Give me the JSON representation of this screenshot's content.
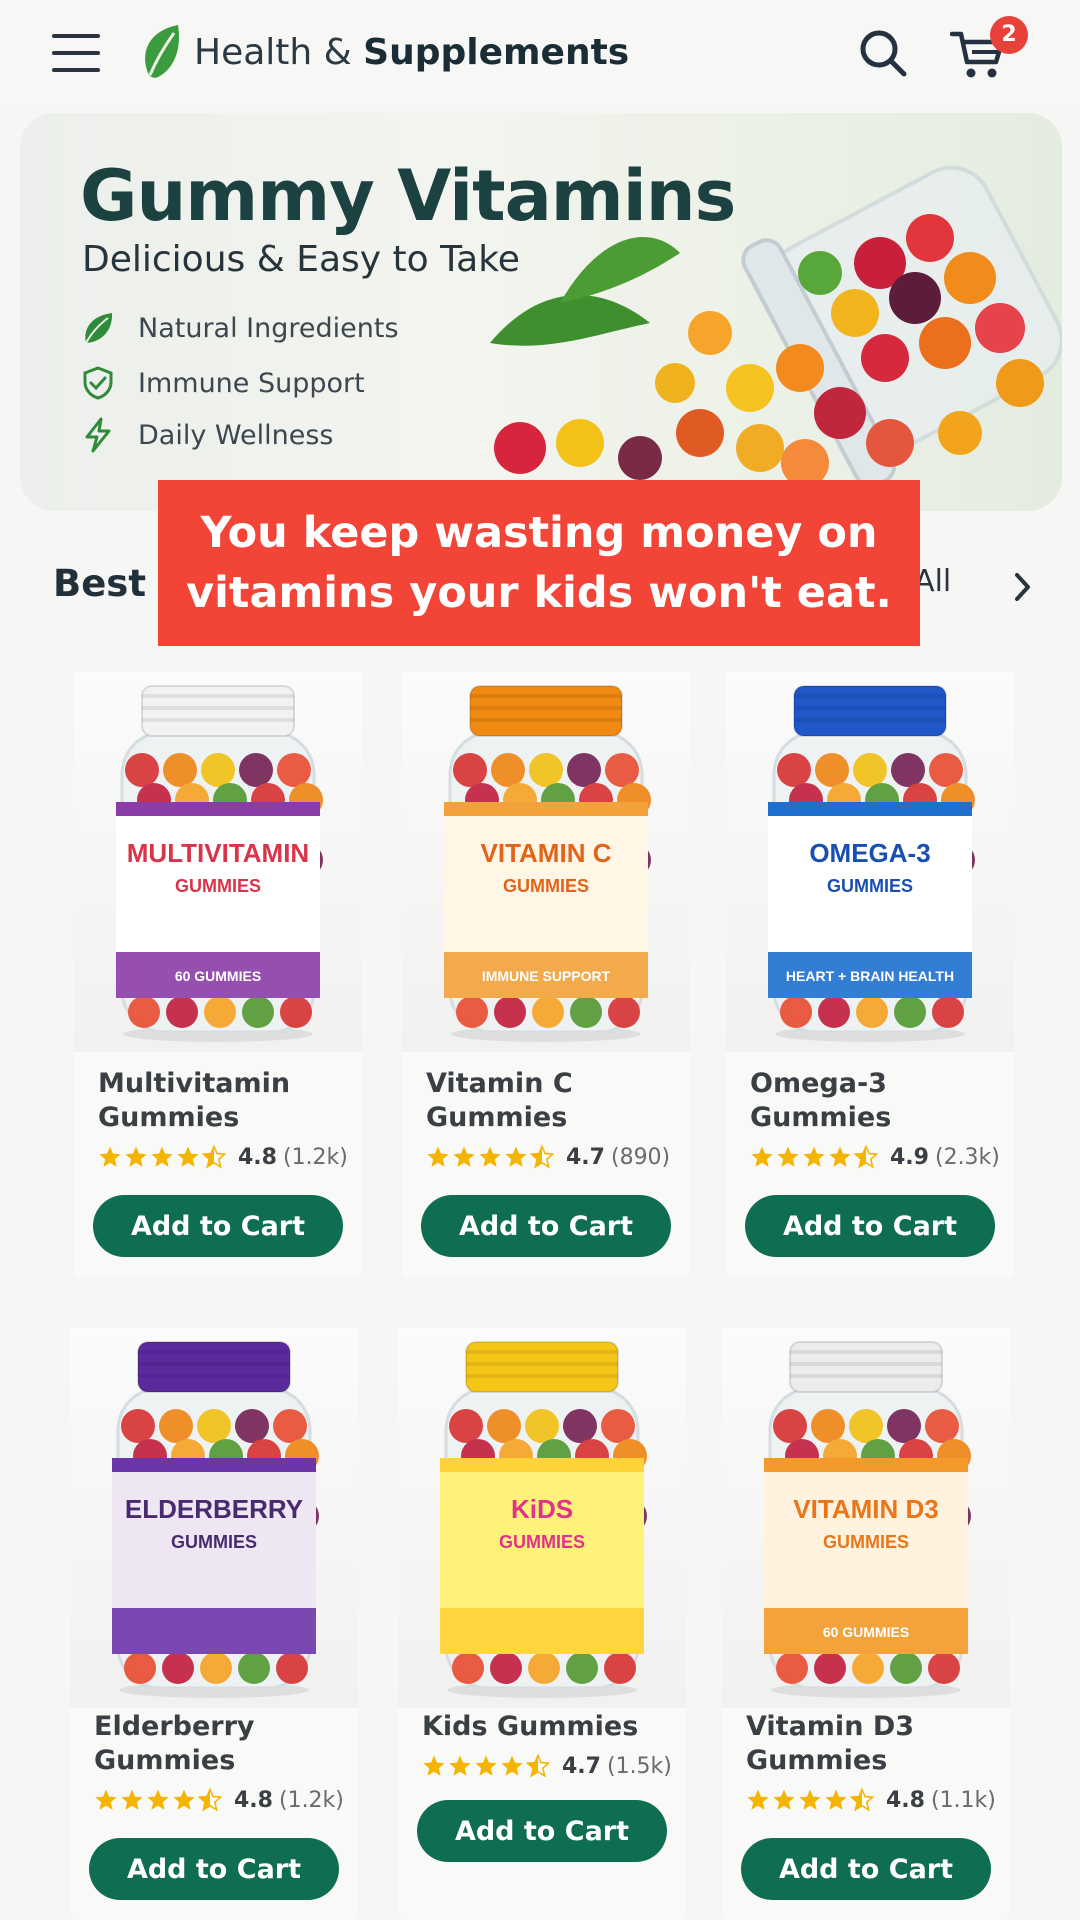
{
  "header": {
    "menu_icon": "hamburger-menu-icon",
    "brand_light": "Health & ",
    "brand_bold": "Supplements",
    "search_icon": "search-icon",
    "cart_icon": "shopping-cart-icon",
    "cart_count": "2",
    "colors": {
      "brand_green": "#3a9a3c",
      "badge_red": "#e8413a"
    }
  },
  "hero": {
    "title": "Gummy Vitamins",
    "subtitle": "Delicious & Easy to Take",
    "features": [
      {
        "icon": "leaf-icon",
        "label": "Natural Ingredients"
      },
      {
        "icon": "shield-check-icon",
        "label": "Immune Support"
      },
      {
        "icon": "lightning-icon",
        "label": "Daily Wellness"
      }
    ]
  },
  "caption": {
    "line1": "You keep wasting money on",
    "line2": "vitamins your kids won't eat."
  },
  "section": {
    "title": "Best S",
    "view_all": "w All",
    "chevron_icon": "chevron-right-icon"
  },
  "products": [
    {
      "name": "Multivitamin Gummies",
      "rating": "4.8",
      "count": "(1.2k)",
      "stars": 4.5,
      "cta": "Add to Cart",
      "label_title": "MULTIVITAMIN",
      "label_sub": "GUMMIES",
      "label_extra": "60 GUMMIES",
      "cap_color": "#f2f2f2",
      "band_color": "#8a3da6",
      "label_color": "#ffffff",
      "accent": "#d8344a"
    },
    {
      "name": "Vitamin C Gummies",
      "rating": "4.7",
      "count": "(890)",
      "stars": 4.5,
      "cta": "Add to Cart",
      "label_title": "VITAMIN C",
      "label_sub": "GUMMIES",
      "label_extra": "IMMUNE SUPPORT",
      "cap_color": "#f08a12",
      "band_color": "#f2a23a",
      "label_color": "#fff6e6",
      "accent": "#e2641a"
    },
    {
      "name": "Omega-3 Gummies",
      "rating": "4.9",
      "count": "(2.3k)",
      "stars": 4.5,
      "cta": "Add to Cart",
      "label_title": "OMEGA-3",
      "label_sub": "GUMMIES",
      "label_extra": "HEART + BRAIN HEALTH",
      "cap_color": "#1f56c8",
      "band_color": "#1e6fd0",
      "label_color": "#ffffff",
      "accent": "#1a4fb2"
    },
    {
      "name": "Elderberry Gummies",
      "rating": "4.8",
      "count": "(1.2k)",
      "stars": 4.5,
      "cta": "Add to Cart",
      "label_title": "ELDERBERRY",
      "label_sub": "GUMMIES",
      "label_extra": "",
      "cap_color": "#5b2b9e",
      "band_color": "#6d36a8",
      "label_color": "#efe6f4",
      "accent": "#4a2a6e"
    },
    {
      "name": "Kids Gummies",
      "rating": "4.7",
      "count": "(1.5k)",
      "stars": 4.5,
      "cta": "Add to Cart",
      "label_title": "KiDS",
      "label_sub": "GUMMIES",
      "label_extra": "",
      "cap_color": "#f5c518",
      "band_color": "#ffd23a",
      "label_color": "#fff27a",
      "accent": "#e0338a"
    },
    {
      "name": "Vitamin D3 Gummies",
      "rating": "4.8",
      "count": "(1.1k)",
      "stars": 4.5,
      "cta": "Add to Cart",
      "label_title": "VITAMIN D3",
      "label_sub": "GUMMIES",
      "label_extra": "60 GUMMIES",
      "cap_color": "#ececec",
      "band_color": "#f39a2a",
      "label_color": "#fff3e0",
      "accent": "#e9761a"
    }
  ]
}
